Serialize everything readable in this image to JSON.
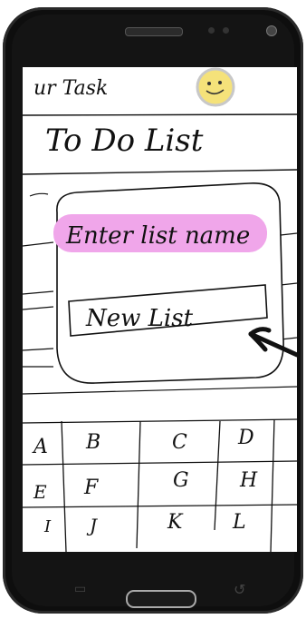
{
  "app": {
    "header_text": "ur Task",
    "title": "To Do List"
  },
  "dialog": {
    "label": "Enter list name",
    "input_value": "New List"
  },
  "grid": {
    "rows": [
      [
        "A",
        "B",
        "C",
        "D"
      ],
      [
        "E",
        "F",
        "G",
        "H"
      ],
      [
        "I",
        "J",
        "K",
        "L"
      ]
    ]
  },
  "colors": {
    "highlight": "#f0a6ea",
    "smiley": "#f5e27a"
  },
  "icons": [
    "smiley-icon",
    "arrow-icon"
  ]
}
